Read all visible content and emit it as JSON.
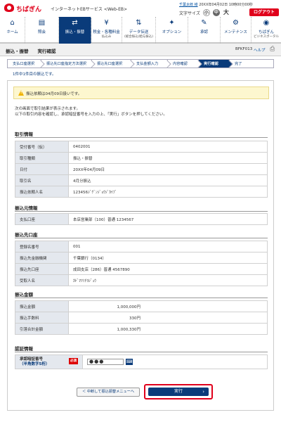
{
  "header": {
    "logo": "ちばぎん",
    "service": "インターネットEBサービス <Web-EB>",
    "user_name": "千葉太郎 様",
    "last_login": "20XX年04月02日 10時00分00秒",
    "font_size_label": "文字サイズ",
    "font_small": "小",
    "font_mid": "中",
    "font_large": "大",
    "logout": "ログアウト"
  },
  "nav": [
    {
      "icon": "home-icon",
      "glyph": "⌂",
      "label": "ホーム",
      "sub": ""
    },
    {
      "icon": "inquiry-icon",
      "glyph": "▤",
      "label": "照会",
      "sub": ""
    },
    {
      "icon": "transfer-icon",
      "glyph": "⇄",
      "label": "振込・振替",
      "sub": "",
      "active": true
    },
    {
      "icon": "tax-payment-icon",
      "glyph": "¥",
      "label": "税金・各種料金",
      "sub": "払込み"
    },
    {
      "icon": "data-transfer-icon",
      "glyph": "⇅",
      "label": "データ伝送",
      "sub": "(総合振込/給与振込)"
    },
    {
      "icon": "option-icon",
      "glyph": "✦",
      "label": "オプション",
      "sub": ""
    },
    {
      "icon": "approval-icon",
      "glyph": "✎",
      "label": "承認",
      "sub": ""
    },
    {
      "icon": "maintenance-icon",
      "glyph": "⚙",
      "label": "メンテナンス",
      "sub": ""
    },
    {
      "icon": "portal-icon",
      "glyph": "◉",
      "label": "ちばぎん",
      "sub": "ビジネスポータル"
    }
  ],
  "titlebar": {
    "title": "振込・振替　　実行確認",
    "screen_id": "BFKF013",
    "help": "ヘルプ"
  },
  "steps": [
    "支払口座選択",
    "振込先口座指定方法選択",
    "振込先口座選択",
    "支払金額入力",
    "内容確認",
    "実行確認",
    "完了"
  ],
  "current_step": 5,
  "status_line": "1件中1件目の振込です。",
  "alert": "振込依頼は04月09日扱いです。",
  "instructions": [
    "次の画面で取引結果が表示されます。",
    "以下の取引内容を確認し、承認暗証番号を入力の上、「実行」ボタンを押してください。"
  ],
  "sections": {
    "transaction": {
      "title": "取引情報",
      "rows": [
        {
          "label": "受付番号（仮）",
          "value": "0402001"
        },
        {
          "label": "取引種類",
          "value": "振込・振替"
        },
        {
          "label": "日付",
          "value": "20XX年04月09日"
        },
        {
          "label": "取引名",
          "value": "4月分振込"
        },
        {
          "label": "振込依頼人名",
          "value": "123456ｼﾞｹﾞﾝｼﾞｮｳｼﾞｶｲﾌﾞ"
        }
      ]
    },
    "source": {
      "title": "振込元情報",
      "rows": [
        {
          "label": "支払口座",
          "value": "本店営業部（100）普通 1234567"
        }
      ]
    },
    "destination": {
      "title": "振込先口座",
      "rows": [
        {
          "label": "登録名番号",
          "value": "001"
        },
        {
          "label": "振込先金融機関",
          "value": "千葉銀行（0134）"
        },
        {
          "label": "振込先口座",
          "value": "成田支店（286）普通 4567890"
        },
        {
          "label": "受取人名",
          "value": "ｶﾄﾞﾏﾂﾐﾁﾖｼﾞｭｳ"
        }
      ]
    },
    "amount": {
      "title": "振込金額",
      "rows": [
        {
          "label": "振込金額",
          "value": "1,000,000円"
        },
        {
          "label": "振込手数料",
          "value": "330円"
        },
        {
          "label": "引落合計金額",
          "value": "1,000,330円"
        }
      ]
    },
    "auth": {
      "title": "認証情報",
      "label_line1": "承認暗証番号",
      "label_line2": "（半角数字5桁）",
      "required": "必須",
      "value": "●●●"
    }
  },
  "buttons": {
    "back": "＜ 中断して振込振替メニューへ",
    "execute": "実行",
    "execute_arrow": "›"
  }
}
